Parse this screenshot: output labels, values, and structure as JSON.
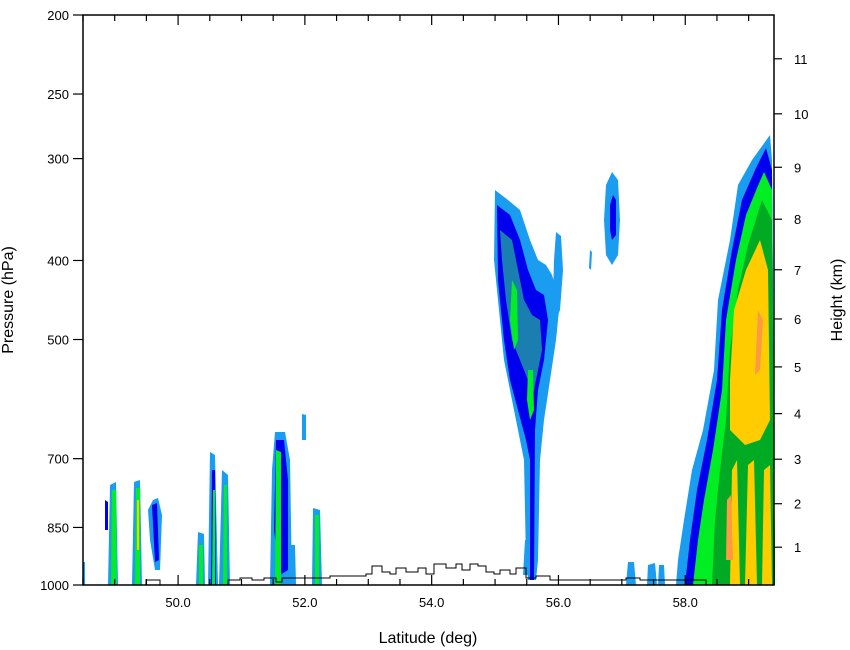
{
  "chart_data": {
    "type": "heatmap",
    "title": "",
    "xlabel": "Latitude (deg)",
    "ylabel_left": "Pressure (hPa)",
    "ylabel_right": "Height (km)",
    "xlim": [
      48.5,
      59.4
    ],
    "ylim_pressure": [
      1000,
      200
    ],
    "y_scale": "log",
    "x_ticks": [
      "50.0",
      "52.0",
      "54.0",
      "56.0",
      "58.0"
    ],
    "x_tick_values": [
      50.0,
      52.0,
      54.0,
      56.0,
      58.0
    ],
    "left_ticks": [
      "200",
      "250",
      "300",
      "400",
      "500",
      "700",
      "850",
      "1000"
    ],
    "left_tick_values": [
      200,
      250,
      300,
      400,
      500,
      700,
      850,
      1000
    ],
    "right_ticks": [
      "1",
      "2",
      "3",
      "4",
      "5",
      "6",
      "7",
      "8",
      "9",
      "10",
      "11"
    ],
    "right_tick_values": [
      1,
      2,
      3,
      4,
      5,
      6,
      7,
      8,
      9,
      10,
      11
    ],
    "grid": false,
    "legend": "none",
    "colors": [
      "#1a9cf0",
      "#0000ee",
      "#1a7fb0",
      "#00ee22",
      "#00aa22",
      "#ffcc00",
      "#ff9944"
    ],
    "features": [
      {
        "lat": 55.4,
        "p_top": 335,
        "p_bottom": 1000,
        "core": "green"
      },
      {
        "lat": 56.9,
        "p_top": 310,
        "p_bottom": 410,
        "core": "blue"
      },
      {
        "lat": 58.9,
        "p_top": 280,
        "p_bottom": 1000,
        "core": "yellow"
      },
      {
        "lat": 51.6,
        "p_top": 650,
        "p_bottom": 1000,
        "core": "green"
      }
    ],
    "terrain_max_pressure": 960
  }
}
